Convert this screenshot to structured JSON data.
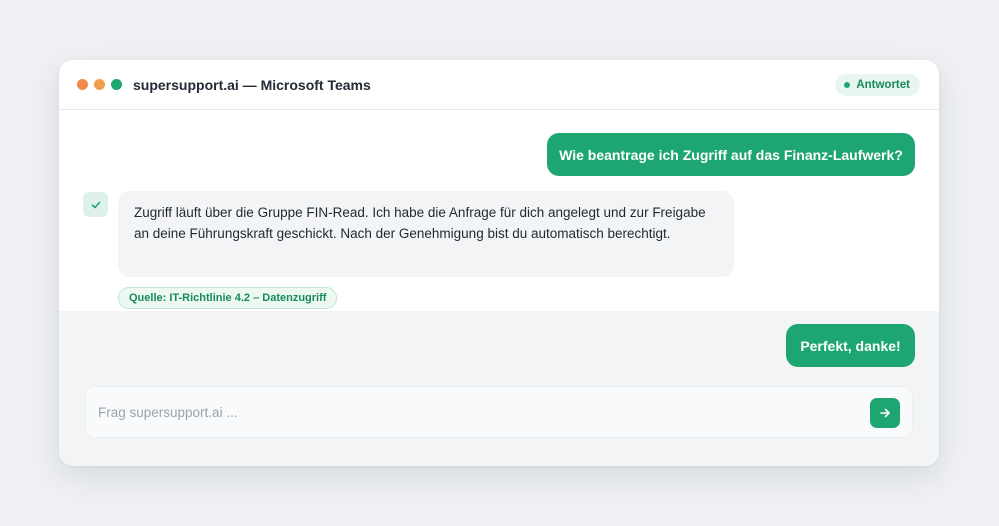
{
  "window": {
    "title": "supersupport.ai — Microsoft Teams",
    "status": "Antwortet"
  },
  "messages": {
    "user_question": "Wie beantrage ich Zugriff auf das Finanz-Laufwerk?",
    "bot_answer": "Zugriff läuft über die Gruppe FIN-Read. Ich habe die Anfrage für dich angelegt und zur Freigabe an deine Führungskraft geschickt. Nach der Genehmigung bist du automatisch berechtigt.",
    "bot_source": "Quelle: IT-Richtlinie 4.2 – Datenzugriff",
    "user_reply": "Perfekt, danke!"
  },
  "composer": {
    "placeholder": "Frag supersupport.ai ..."
  },
  "icons": {
    "bot_avatar": "check-icon",
    "send": "arrow-right-icon"
  },
  "colors": {
    "accent": "#1ea672",
    "dot_1": "#f0894b",
    "dot_2": "#f0a04b",
    "dot_3": "#1ea672"
  }
}
